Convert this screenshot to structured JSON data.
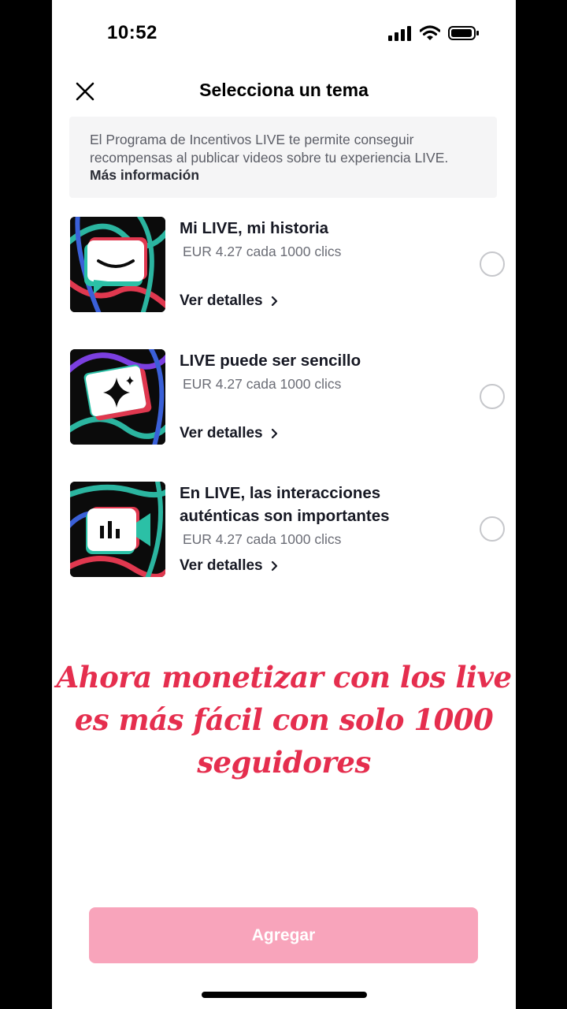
{
  "status_bar": {
    "time": "10:52"
  },
  "header": {
    "title": "Selecciona un tema"
  },
  "info": {
    "text": "El Programa de Incentivos LIVE te permite conseguir recompensas al publicar videos sobre tu experiencia LIVE. ",
    "link": "Más información"
  },
  "topics": [
    {
      "title": "Mi LIVE, mi historia",
      "rate": "EUR 4.27 cada 1000 clics",
      "details": "Ver detalles",
      "icon": "chat-bubble-smile-icon",
      "selected": false
    },
    {
      "title": "LIVE puede ser sencillo",
      "rate": "EUR 4.27 cada 1000 clics",
      "details": "Ver detalles",
      "icon": "sparkle-ticket-icon",
      "selected": false
    },
    {
      "title": "En LIVE, las interacciones auténticas son importantes",
      "rate": "EUR 4.27 cada 1000 clics",
      "details": "Ver detalles",
      "icon": "video-camera-bars-icon",
      "selected": false
    }
  ],
  "overlay_caption": "Ahora monetizar con los live es más fácil con solo 1000 seguidores",
  "add_button": {
    "label": "Agregar"
  },
  "colors": {
    "accent": "#fe2c55",
    "button_disabled": "#f8a4bb",
    "overlay_text": "#e52e4e"
  }
}
